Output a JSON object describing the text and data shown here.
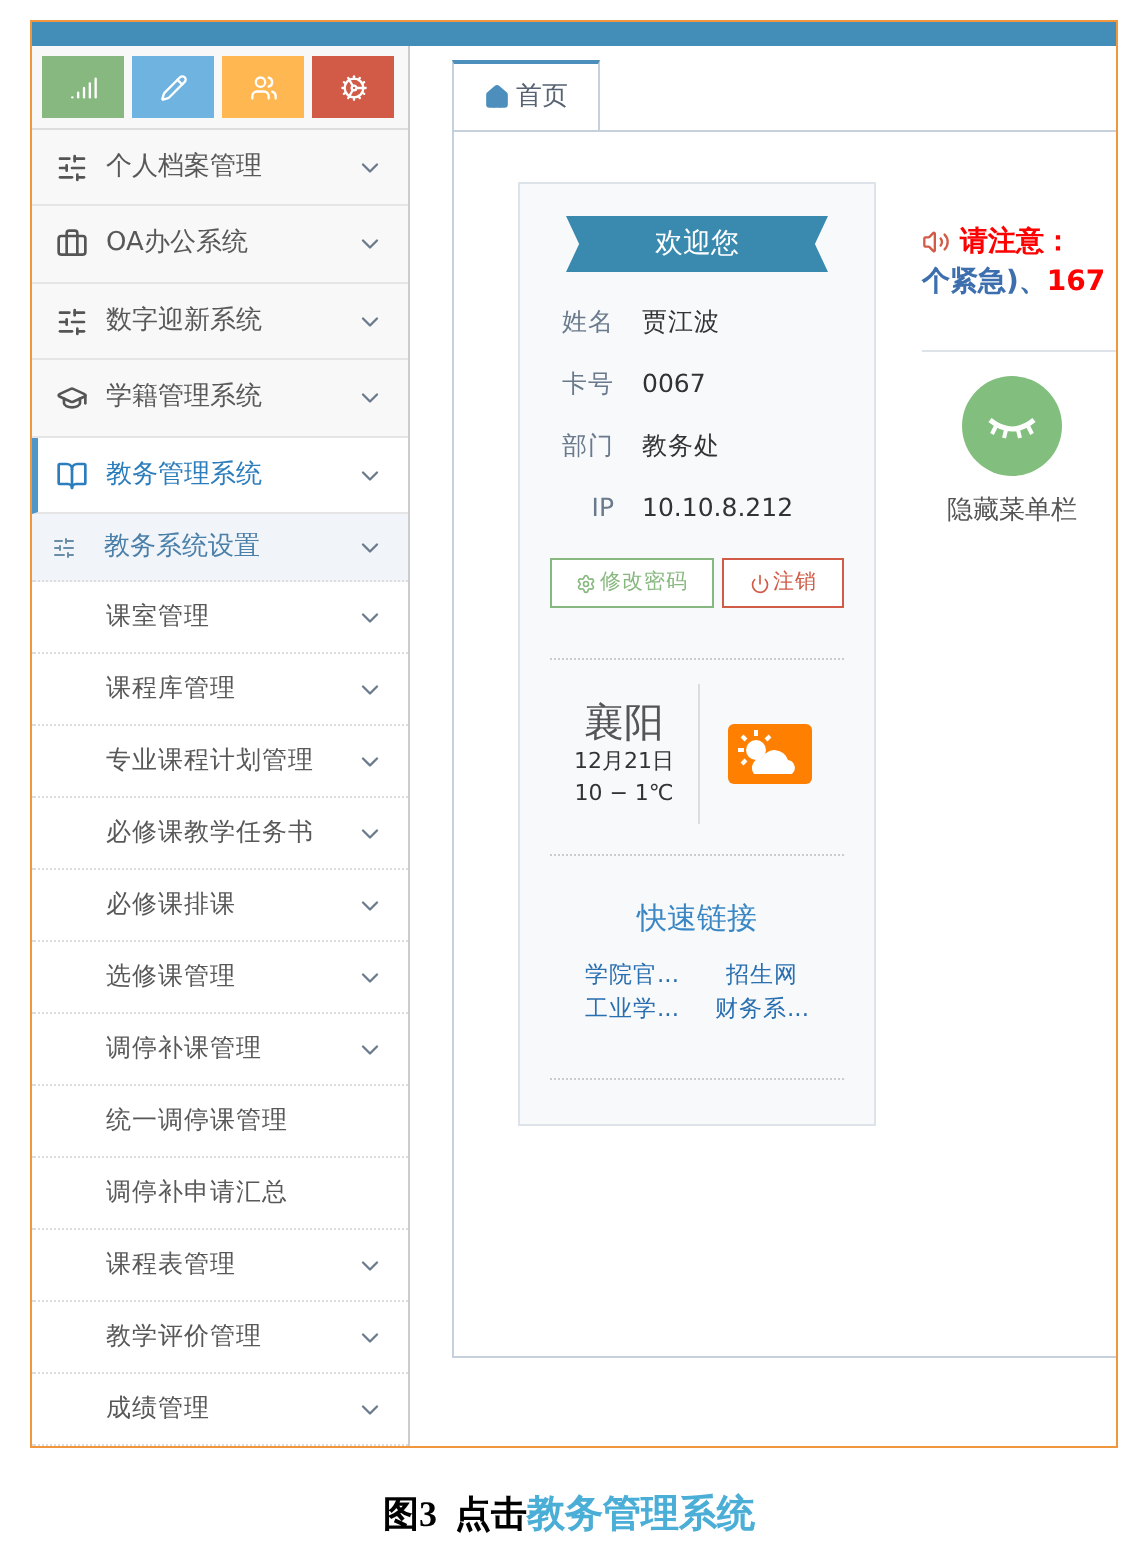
{
  "toolbar": [
    {
      "kind": "signal",
      "color": "#87b87f"
    },
    {
      "kind": "pencil",
      "color": "#6fb3e0"
    },
    {
      "kind": "users",
      "color": "#ffb752"
    },
    {
      "kind": "cogs",
      "color": "#d15b47"
    }
  ],
  "sidebar": {
    "items": [
      {
        "label": "个人档案管理",
        "kind": "sliders",
        "selected": false
      },
      {
        "label": "OA办公系统",
        "kind": "briefcase",
        "selected": false
      },
      {
        "label": "数字迎新系统",
        "kind": "sliders",
        "selected": false
      },
      {
        "label": "学籍管理系统",
        "kind": "cap",
        "selected": false
      },
      {
        "label": "教务管理系统",
        "kind": "book",
        "selected": true,
        "children": [
          {
            "label": "教务系统设置",
            "expandable": true,
            "children": [
              {
                "label": "课室管理",
                "expandable": true
              },
              {
                "label": "课程库管理",
                "expandable": true
              },
              {
                "label": "专业课程计划管理",
                "expandable": true
              },
              {
                "label": "必修课教学任务书",
                "expandable": true
              },
              {
                "label": "必修课排课",
                "expandable": true
              },
              {
                "label": "选修课管理",
                "expandable": true
              },
              {
                "label": "调停补课管理",
                "expandable": true
              },
              {
                "label": "统一调停课管理",
                "expandable": false
              },
              {
                "label": "调停补申请汇总",
                "expandable": false
              },
              {
                "label": "课程表管理",
                "expandable": true
              },
              {
                "label": "教学评价管理",
                "expandable": true
              },
              {
                "label": "成绩管理",
                "expandable": true
              }
            ]
          }
        ]
      }
    ]
  },
  "tabs": [
    {
      "label": "首页",
      "selected": true
    }
  ],
  "profile": {
    "banner": "欢迎您",
    "fields": [
      {
        "label": "姓名",
        "value": "贾江波"
      },
      {
        "label": "卡号",
        "value": "0067"
      },
      {
        "label": "部门",
        "value": "教务处"
      },
      {
        "label": "IP",
        "value": "10.10.8.212"
      }
    ],
    "buttons": [
      {
        "label": "修改密码",
        "kind": "change"
      },
      {
        "label": "注销",
        "kind": "logout"
      }
    ]
  },
  "weather": {
    "city": "襄阳",
    "date": "12月21日",
    "temp": "10 − 1℃"
  },
  "quick_links": {
    "title": "快速链接",
    "links": [
      "学院官...",
      "招生网",
      "工业学...",
      "财务系..."
    ]
  },
  "notice": {
    "lines": [
      [
        {
          "text": "请注意：",
          "kind": "alert"
        }
      ],
      [
        {
          "text": "个紧急)、",
          "kind": "info"
        },
        {
          "text": "167",
          "kind": "alert"
        }
      ]
    ]
  },
  "hide_menu": {
    "label": "隐藏菜单栏"
  },
  "caption": [
    {
      "text": "图3  点击",
      "kind": "plain"
    },
    {
      "text": "教务管理系统",
      "kind": "highlight"
    }
  ]
}
